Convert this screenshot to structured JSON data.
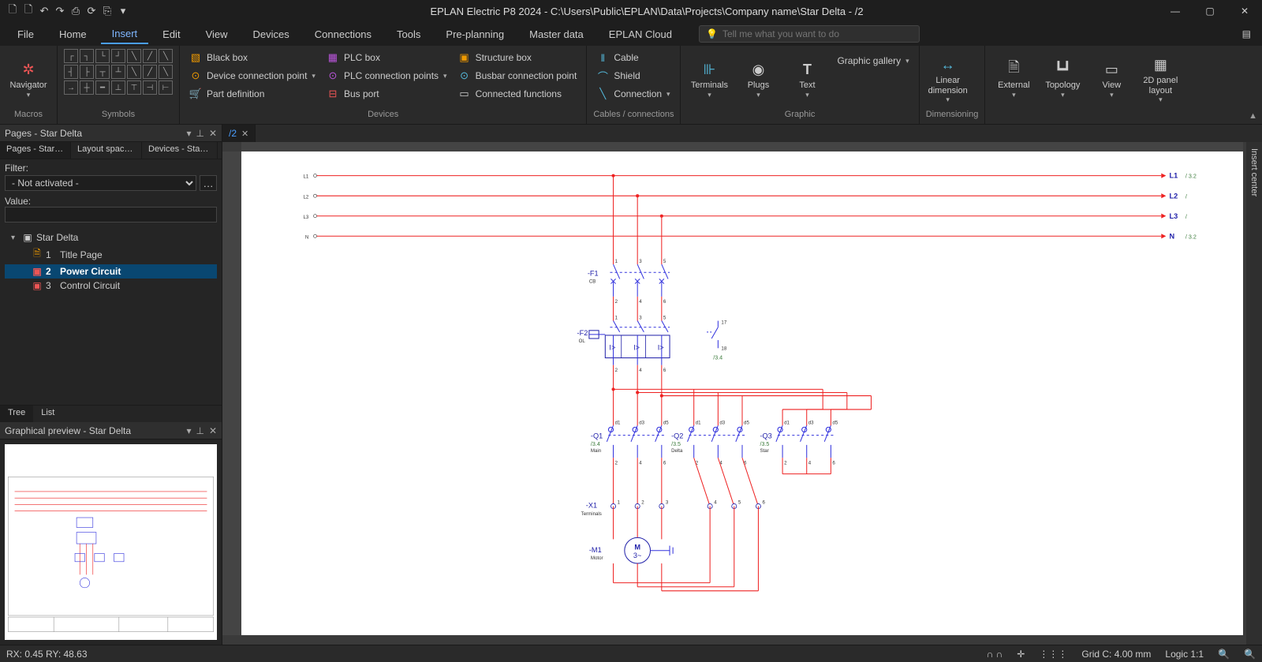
{
  "app": {
    "title": "EPLAN Electric P8 2024 - C:\\Users\\Public\\EPLAN\\Data\\Projects\\Company name\\Star Delta - /2"
  },
  "qat_icons": [
    "new-icon",
    "open-icon",
    "undo-icon",
    "redo-icon",
    "save-icon",
    "refresh-icon",
    "settings-icon",
    "dropdown-icon"
  ],
  "menu_tabs": [
    "File",
    "Home",
    "Insert",
    "Edit",
    "View",
    "Devices",
    "Connections",
    "Tools",
    "Pre-planning",
    "Master data",
    "EPLAN Cloud"
  ],
  "menu_active": "Insert",
  "tell_me_placeholder": "Tell me what you want to do",
  "ribbon": {
    "groups": {
      "macros": {
        "label": "Macros",
        "navigator": "Navigator"
      },
      "symbols": {
        "label": "Symbols"
      },
      "devices": {
        "label": "Devices",
        "black_box": "Black box",
        "dev_conn_point": "Device connection point",
        "part_def": "Part definition",
        "plc_box": "PLC box",
        "plc_conn_points": "PLC connection points",
        "bus_port": "Bus port",
        "structure_box": "Structure box",
        "busbar_conn_point": "Busbar connection point",
        "connected_funcs": "Connected functions"
      },
      "cables": {
        "label": "Cables / connections",
        "cable": "Cable",
        "shield": "Shield",
        "connection": "Connection"
      },
      "terminals": "Terminals",
      "plugs": "Plugs",
      "text": "Text",
      "graphic_gallery": "Graphic gallery",
      "graphic": {
        "label": "Graphic"
      },
      "dimensioning": {
        "label": "Dimensioning",
        "linear": "Linear dimension"
      },
      "external": "External",
      "topology": "Topology",
      "view": "View",
      "panel2d": "2D panel layout"
    }
  },
  "pages_panel": {
    "title": "Pages - Star Delta",
    "tabs": [
      "Pages - Star D…",
      "Layout space - …",
      "Devices - Star …"
    ],
    "filter_label": "Filter:",
    "filter_value": "- Not activated -",
    "value_label": "Value:",
    "value_text": "",
    "tree_root": "Star Delta",
    "tree_items": [
      {
        "num": "1",
        "name": "Title Page",
        "sel": false
      },
      {
        "num": "2",
        "name": "Power Circuit",
        "sel": true
      },
      {
        "num": "3",
        "name": "Control Circuit",
        "sel": false
      }
    ],
    "footer": [
      "Tree",
      "List"
    ]
  },
  "preview_panel": {
    "title": "Graphical preview - Star Delta"
  },
  "doc_tab": {
    "label": "/2"
  },
  "insert_center": "Insert center",
  "status": {
    "coords": "RX: 0.45 RY: 48.63",
    "grid": "Grid C: 4.00 mm",
    "logic": "Logic 1:1"
  },
  "schematic": {
    "rails": [
      {
        "left": "L1",
        "right": "L1",
        "xref": "/ 3.2"
      },
      {
        "left": "L2",
        "right": "L2",
        "xref": "/"
      },
      {
        "left": "L3",
        "right": "L3",
        "xref": "/"
      },
      {
        "left": "N",
        "right": "N",
        "xref": "/ 3.2"
      }
    ],
    "devices": {
      "f1": {
        "tag": "-F1",
        "sub": "CB",
        "pins_top": [
          "1",
          "3",
          "5"
        ],
        "pins_bot": [
          "2",
          "4",
          "6"
        ]
      },
      "f2": {
        "tag": "-F2",
        "sub": "OL",
        "pins_top": [
          "1",
          "3",
          "5"
        ],
        "pins_bot": [
          "2",
          "4",
          "6"
        ],
        "aux_top": "17",
        "aux_bot": "18",
        "aux_xref": "/3.4",
        "ol": "I>"
      },
      "q1": {
        "tag": "-Q1",
        "xref": "/3.4",
        "sub": "Main",
        "pins_top": [
          "d1",
          "d3",
          "d5"
        ],
        "pins_bot": [
          "2",
          "4",
          "6"
        ]
      },
      "q2": {
        "tag": "-Q2",
        "xref": "/3.5",
        "sub": "Delta",
        "pins_top": [
          "d1",
          "d3",
          "d5"
        ],
        "pins_bot": [
          "2",
          "4",
          "6"
        ]
      },
      "q3": {
        "tag": "-Q3",
        "xref": "/3.5",
        "sub": "Star",
        "pins_top": [
          "d1",
          "d3",
          "d5"
        ],
        "pins_bot": [
          "2",
          "4",
          "6"
        ]
      },
      "x1": {
        "tag": "-X1",
        "sub": "Terminals",
        "pins": [
          "1",
          "2",
          "3",
          "4",
          "5",
          "6"
        ]
      },
      "m1": {
        "tag": "-M1",
        "sub": "Motor",
        "label": "M",
        "phase": "3~"
      }
    }
  }
}
